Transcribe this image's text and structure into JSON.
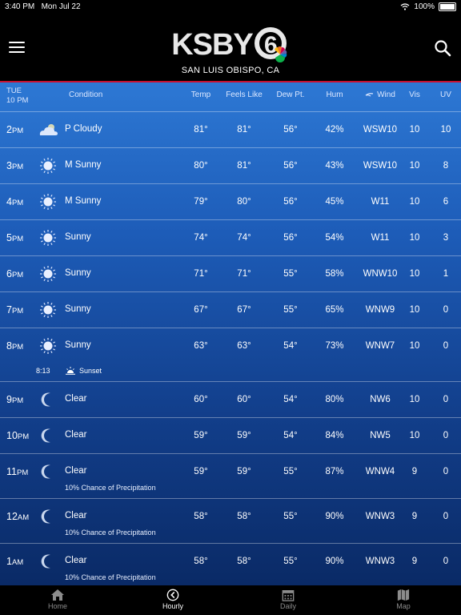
{
  "status_bar": {
    "time": "3:40 PM",
    "date": "Mon Jul 22",
    "battery": "100%"
  },
  "app": {
    "logo": "KSBY",
    "channel": "6",
    "location": "SAN LUIS OBISPO, CA"
  },
  "header": {
    "day": "TUE",
    "time": "10 PM",
    "condition": "Condition",
    "temp": "Temp",
    "feels_like": "Feels Like",
    "dew_point": "Dew Pt.",
    "humidity": "Hum",
    "wind": "Wind",
    "visibility": "Vis",
    "uv": "UV"
  },
  "rows": [
    {
      "hour": "2",
      "ampm": "PM",
      "icon": "partly-cloudy-icon",
      "condition": "P Cloudy",
      "temp": "81°",
      "feels": "81°",
      "dew": "56°",
      "hum": "42%",
      "wind": "WSW10",
      "vis": "10",
      "uv": "10"
    },
    {
      "hour": "3",
      "ampm": "PM",
      "icon": "sun-icon",
      "condition": "M Sunny",
      "temp": "80°",
      "feels": "81°",
      "dew": "56°",
      "hum": "43%",
      "wind": "WSW10",
      "vis": "10",
      "uv": "8"
    },
    {
      "hour": "4",
      "ampm": "PM",
      "icon": "sun-icon",
      "condition": "M Sunny",
      "temp": "79°",
      "feels": "80°",
      "dew": "56°",
      "hum": "45%",
      "wind": "W11",
      "vis": "10",
      "uv": "6"
    },
    {
      "hour": "5",
      "ampm": "PM",
      "icon": "sun-icon",
      "condition": "Sunny",
      "temp": "74°",
      "feels": "74°",
      "dew": "56°",
      "hum": "54%",
      "wind": "W11",
      "vis": "10",
      "uv": "3"
    },
    {
      "hour": "6",
      "ampm": "PM",
      "icon": "sun-icon",
      "condition": "Sunny",
      "temp": "71°",
      "feels": "71°",
      "dew": "55°",
      "hum": "58%",
      "wind": "WNW10",
      "vis": "10",
      "uv": "1"
    },
    {
      "hour": "7",
      "ampm": "PM",
      "icon": "sun-icon",
      "condition": "Sunny",
      "temp": "67°",
      "feels": "67°",
      "dew": "55°",
      "hum": "65%",
      "wind": "WNW9",
      "vis": "10",
      "uv": "0"
    },
    {
      "hour": "8",
      "ampm": "PM",
      "icon": "sun-icon",
      "condition": "Sunny",
      "temp": "63°",
      "feels": "63°",
      "dew": "54°",
      "hum": "73%",
      "wind": "WNW7",
      "vis": "10",
      "uv": "0",
      "sunset_time": "8:13",
      "sunset_label": "Sunset"
    },
    {
      "hour": "9",
      "ampm": "PM",
      "icon": "moon-icon",
      "condition": "Clear",
      "temp": "60°",
      "feels": "60°",
      "dew": "54°",
      "hum": "80%",
      "wind": "NW6",
      "vis": "10",
      "uv": "0"
    },
    {
      "hour": "10",
      "ampm": "PM",
      "icon": "moon-icon",
      "condition": "Clear",
      "temp": "59°",
      "feels": "59°",
      "dew": "54°",
      "hum": "84%",
      "wind": "NW5",
      "vis": "10",
      "uv": "0"
    },
    {
      "hour": "11",
      "ampm": "PM",
      "icon": "moon-icon",
      "condition": "Clear",
      "temp": "59°",
      "feels": "59°",
      "dew": "55°",
      "hum": "87%",
      "wind": "WNW4",
      "vis": "9",
      "uv": "0",
      "precip": "10% Chance of Precipitation"
    },
    {
      "hour": "12",
      "ampm": "AM",
      "icon": "moon-icon",
      "condition": "Clear",
      "temp": "58°",
      "feels": "58°",
      "dew": "55°",
      "hum": "90%",
      "wind": "WNW3",
      "vis": "9",
      "uv": "0",
      "precip": "10% Chance of Precipitation"
    },
    {
      "hour": "1",
      "ampm": "AM",
      "icon": "moon-icon",
      "condition": "Clear",
      "temp": "58°",
      "feels": "58°",
      "dew": "55°",
      "hum": "90%",
      "wind": "WNW3",
      "vis": "9",
      "uv": "0",
      "precip": "10% Chance of Precipitation"
    }
  ],
  "tabs": [
    {
      "label": "Home",
      "icon": "home-icon"
    },
    {
      "label": "Hourly",
      "icon": "hourly-icon",
      "active": true
    },
    {
      "label": "Daily",
      "icon": "calendar-icon"
    },
    {
      "label": "Map",
      "icon": "map-icon"
    }
  ],
  "colors": {
    "brand_red": "#c8102e",
    "sky_top": "#2d78d4",
    "sky_bottom": "#0a2a66"
  }
}
